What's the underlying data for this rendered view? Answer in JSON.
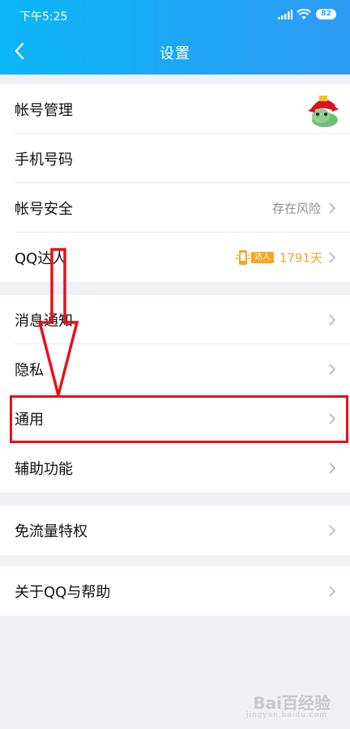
{
  "status_bar": {
    "time": "下午5:25",
    "battery": "82"
  },
  "nav": {
    "title": "设置"
  },
  "groups": [
    {
      "items": [
        {
          "label": "帐号管理",
          "value": ""
        },
        {
          "label": "手机号码",
          "value": ""
        },
        {
          "label": "帐号安全",
          "value": "存在风险"
        },
        {
          "label": "QQ达人",
          "badge": "达人",
          "days": "1791天"
        }
      ]
    },
    {
      "items": [
        {
          "label": "消息通知"
        },
        {
          "label": "隐私"
        },
        {
          "label": "通用"
        },
        {
          "label": "辅助功能"
        }
      ]
    },
    {
      "items": [
        {
          "label": "免流量特权"
        }
      ]
    },
    {
      "items": [
        {
          "label": "关于QQ与帮助"
        }
      ]
    }
  ],
  "icons": {
    "back": "chevron-left-icon",
    "row_arrow": "chevron-right-icon",
    "signal": "signal-icon",
    "wifi": "wifi-icon"
  },
  "colors": {
    "header_start": "#0bb7f7",
    "header_end": "#2d9bf3",
    "annotation_red": "#e5111a",
    "daren_orange": "#f5a623",
    "page_bg": "#f0f0f5"
  },
  "watermark": {
    "brand": "Bai百经验",
    "sub": "jingyan.baidu.com"
  }
}
